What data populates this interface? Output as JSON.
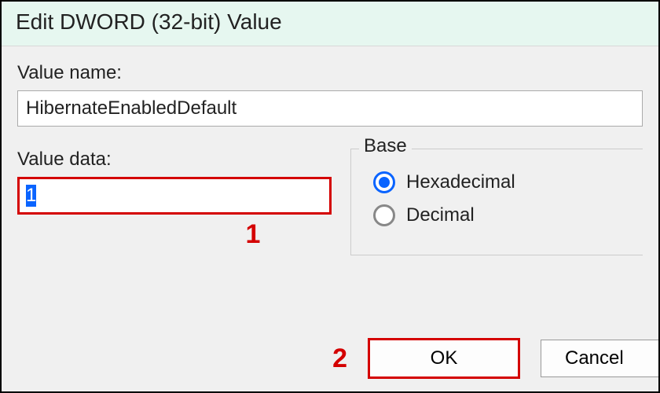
{
  "dialog": {
    "title": "Edit DWORD (32-bit) Value",
    "valueNameLabel": "Value name:",
    "valueName": "HibernateEnabledDefault",
    "valueDataLabel": "Value data:",
    "valueData": "1",
    "base": {
      "legend": "Base",
      "hexLabel": "Hexadecimal",
      "decLabel": "Decimal",
      "selected": "hex"
    },
    "buttons": {
      "ok": "OK",
      "cancel": "Cancel"
    }
  },
  "annotations": {
    "callout1": "1",
    "callout2": "2"
  }
}
